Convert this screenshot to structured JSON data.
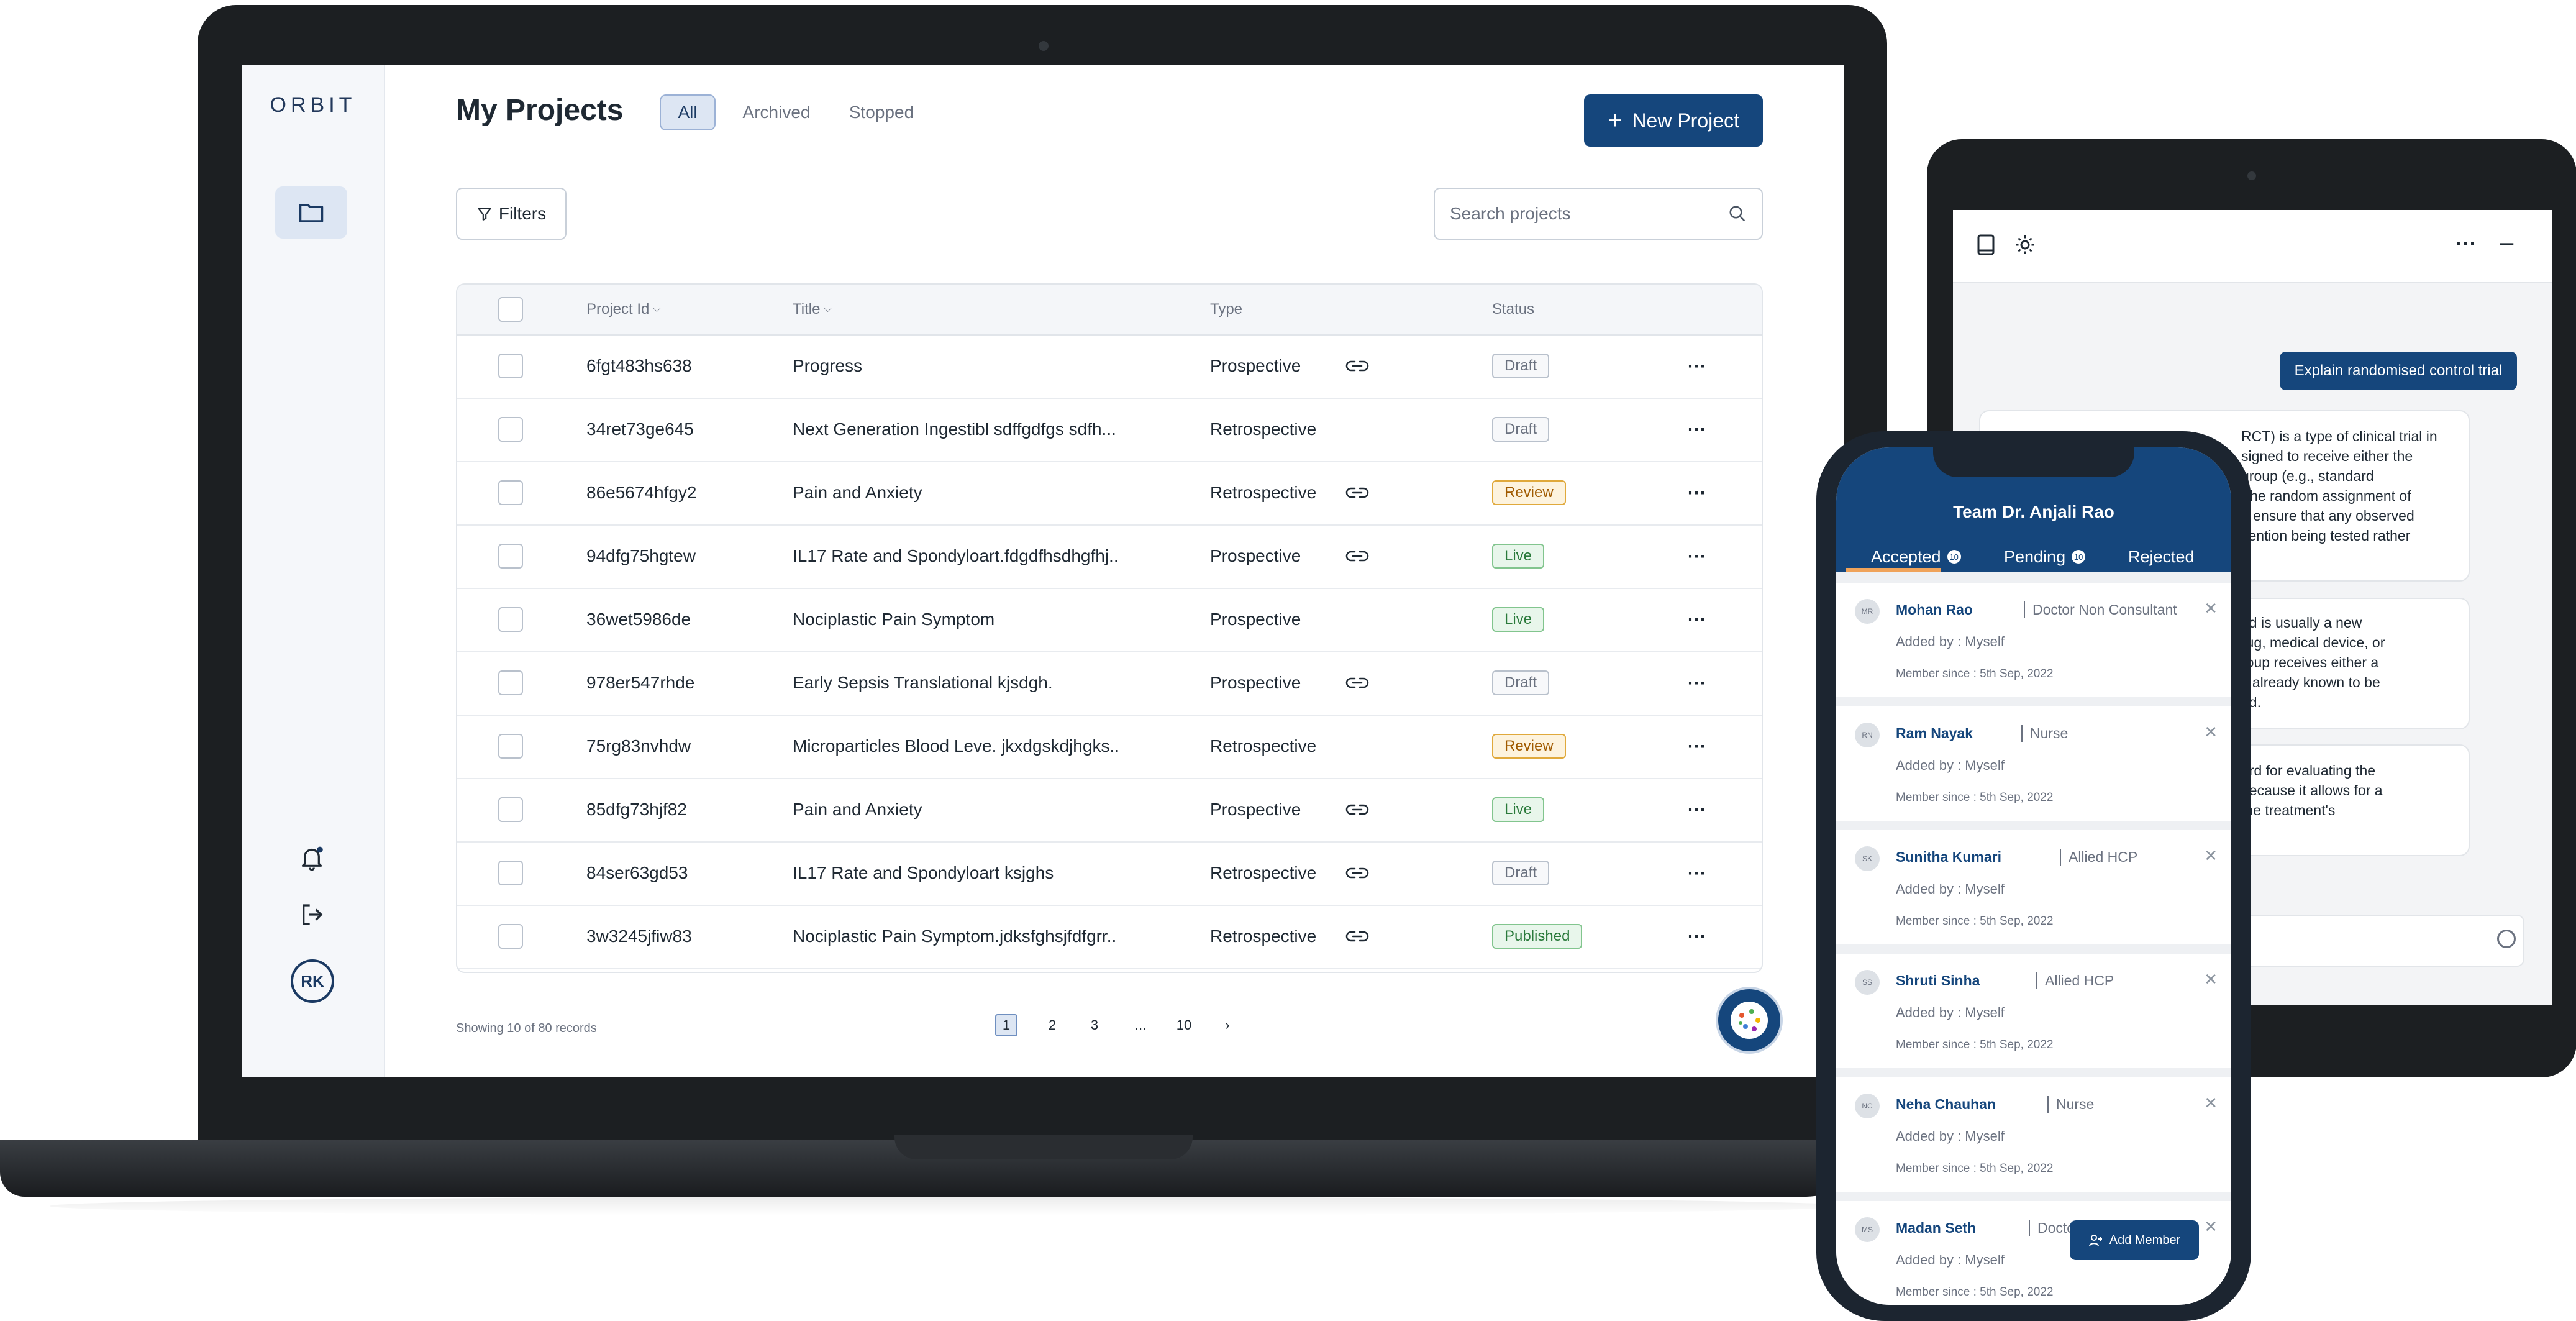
{
  "laptop": {
    "brand": "ORBIT",
    "user_initials": "RK",
    "page_title": "My Projects",
    "tabs": [
      "All",
      "Archived",
      "Stopped"
    ],
    "new_project_label": "New Project",
    "filters_label": "Filters",
    "search_placeholder": "Search projects",
    "columns": [
      "Project Id",
      "Title",
      "Type",
      "Status"
    ],
    "rows": [
      {
        "id": "6fgt483hs638",
        "title": "Progress",
        "type": "Prospective",
        "link": true,
        "status": "Draft"
      },
      {
        "id": "34ret73ge645",
        "title": "Next Generation Ingestibl sdffgdfgs sdfh...",
        "type": "Retrospective",
        "link": false,
        "status": "Draft"
      },
      {
        "id": "86e5674hfgy2",
        "title": "Pain and Anxiety",
        "type": "Retrospective",
        "link": true,
        "status": "Review"
      },
      {
        "id": "94dfg75hgtew",
        "title": "IL17 Rate and Spondyloart.fdgdfhsdhgfhj..",
        "type": "Prospective",
        "link": true,
        "status": "Live"
      },
      {
        "id": "36wet5986de",
        "title": "Nociplastic Pain Symptom",
        "type": "Prospective",
        "link": false,
        "status": "Live"
      },
      {
        "id": "978er547rhde",
        "title": "Early Sepsis Translational kjsdgh.",
        "type": "Prospective",
        "link": true,
        "status": "Draft"
      },
      {
        "id": "75rg83nvhdw",
        "title": "Microparticles Blood Leve. jkxdgskdjhgks..",
        "type": "Retrospective",
        "link": false,
        "status": "Review"
      },
      {
        "id": "85dfg73hjf82",
        "title": "Pain and Anxiety",
        "type": "Prospective",
        "link": true,
        "status": "Live"
      },
      {
        "id": "84ser63gd53",
        "title": "IL17 Rate and Spondyloart ksjghs",
        "type": "Retrospective",
        "link": true,
        "status": "Draft"
      },
      {
        "id": "3w3245jfiw83",
        "title": "Nociplastic Pain Symptom.jdksfghsjfdfgrr..",
        "type": "Retrospective",
        "link": true,
        "status": "Published"
      }
    ],
    "records_text": "Showing 10 of 80 records",
    "pagination": [
      "1",
      "2",
      "3",
      "...",
      "10"
    ],
    "current_page": "1",
    "status_colors": {
      "Draft": "#6b7280",
      "Review": "#a05a00",
      "Live": "#2a7a3b",
      "Published": "#2a7a3b"
    },
    "accent": "#15467c"
  },
  "tablet": {
    "user_prompt": "Explain randomised control trial",
    "messages": [
      [
        "RCT) is a type of clinical trial in",
        "signed to receive either the",
        "group (e.g., standard",
        "The random assignment of",
        "d ensure that any observed",
        "vention being tested rather"
      ],
      [
        "ed is usually a new",
        "rug, medical device, or",
        "roup receives either a",
        "s already known to be",
        "ed."
      ],
      [
        "ard for evaluating the",
        "because it allows for a",
        "the treatment's"
      ]
    ]
  },
  "phone": {
    "team_title": "Team Dr. Anjali Rao",
    "tabs": [
      {
        "label": "Accepted",
        "count": "10"
      },
      {
        "label": "Pending",
        "count": "10"
      },
      {
        "label": "Rejected",
        "count": ""
      }
    ],
    "members": [
      {
        "initials": "MR",
        "name": "Mohan Rao",
        "role": "Doctor Non Consultant",
        "added": "Added by : Myself",
        "since": "Member since  : 5th Sep, 2022"
      },
      {
        "initials": "RN",
        "name": "Ram Nayak",
        "role": "Nurse",
        "added": "Added by : Myself",
        "since": "Member since  : 5th Sep, 2022"
      },
      {
        "initials": "SK",
        "name": "Sunitha Kumari",
        "role": "Allied HCP",
        "added": "Added by : Myself",
        "since": "Member since  : 5th Sep, 2022"
      },
      {
        "initials": "SS",
        "name": "Shruti Sinha",
        "role": "Allied HCP",
        "added": "Added by : Myself",
        "since": "Member since  : 5th Sep, 2022"
      },
      {
        "initials": "NC",
        "name": "Neha Chauhan",
        "role": "Nurse",
        "added": "Added by : Myself",
        "since": "Member since  : 5th Sep, 2022"
      },
      {
        "initials": "MS",
        "name": "Madan Seth",
        "role": "Doctor Non Consultant",
        "added": "Added by : Myself",
        "since": "Member since  : 5th Sep, 2022"
      }
    ],
    "add_member_label": "Add Member"
  }
}
